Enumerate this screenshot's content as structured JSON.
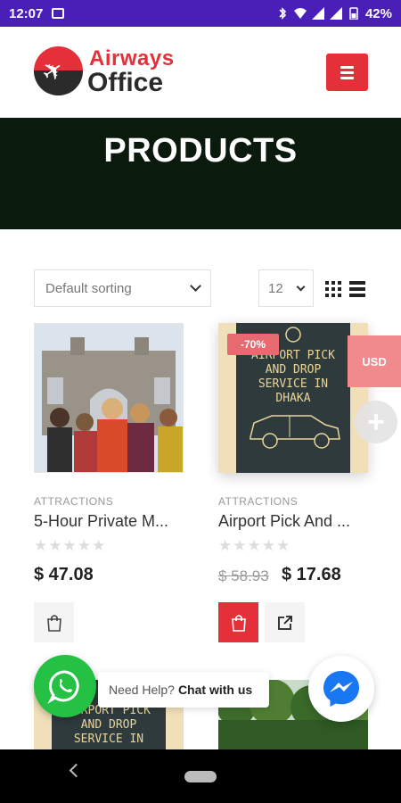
{
  "statusbar": {
    "time": "12:07",
    "battery": "42%"
  },
  "header": {
    "brand_top": "Airways",
    "brand_bottom": "Office"
  },
  "banner": {
    "title": "PRODUCTS"
  },
  "toolbar": {
    "sort_value": "Default sorting",
    "count_value": "12"
  },
  "products": [
    {
      "category": "ATTRACTIONS",
      "title": "5-Hour Private M...",
      "price": "$ 47.08"
    },
    {
      "category": "ATTRACTIONS",
      "title": "Airport Pick And ...",
      "old_price": "$ 58.93",
      "price": "$ 17.68",
      "badge": "-70%",
      "image_text": "AIRPORT PICK AND DROP SERVICE IN DHAKA"
    }
  ],
  "partial_products": [
    {
      "image_text": "AIRPORT PICK AND DROP SERVICE IN DHAKA"
    }
  ],
  "currency_tab": "USD",
  "chat": {
    "prompt": "Need Help?",
    "action": "Chat with us"
  },
  "colors": {
    "status_bar": "#4a1fb8",
    "accent": "#e5303a",
    "banner": "#0a1a0c",
    "whatsapp": "#25c144",
    "messenger": "#1877f2"
  }
}
